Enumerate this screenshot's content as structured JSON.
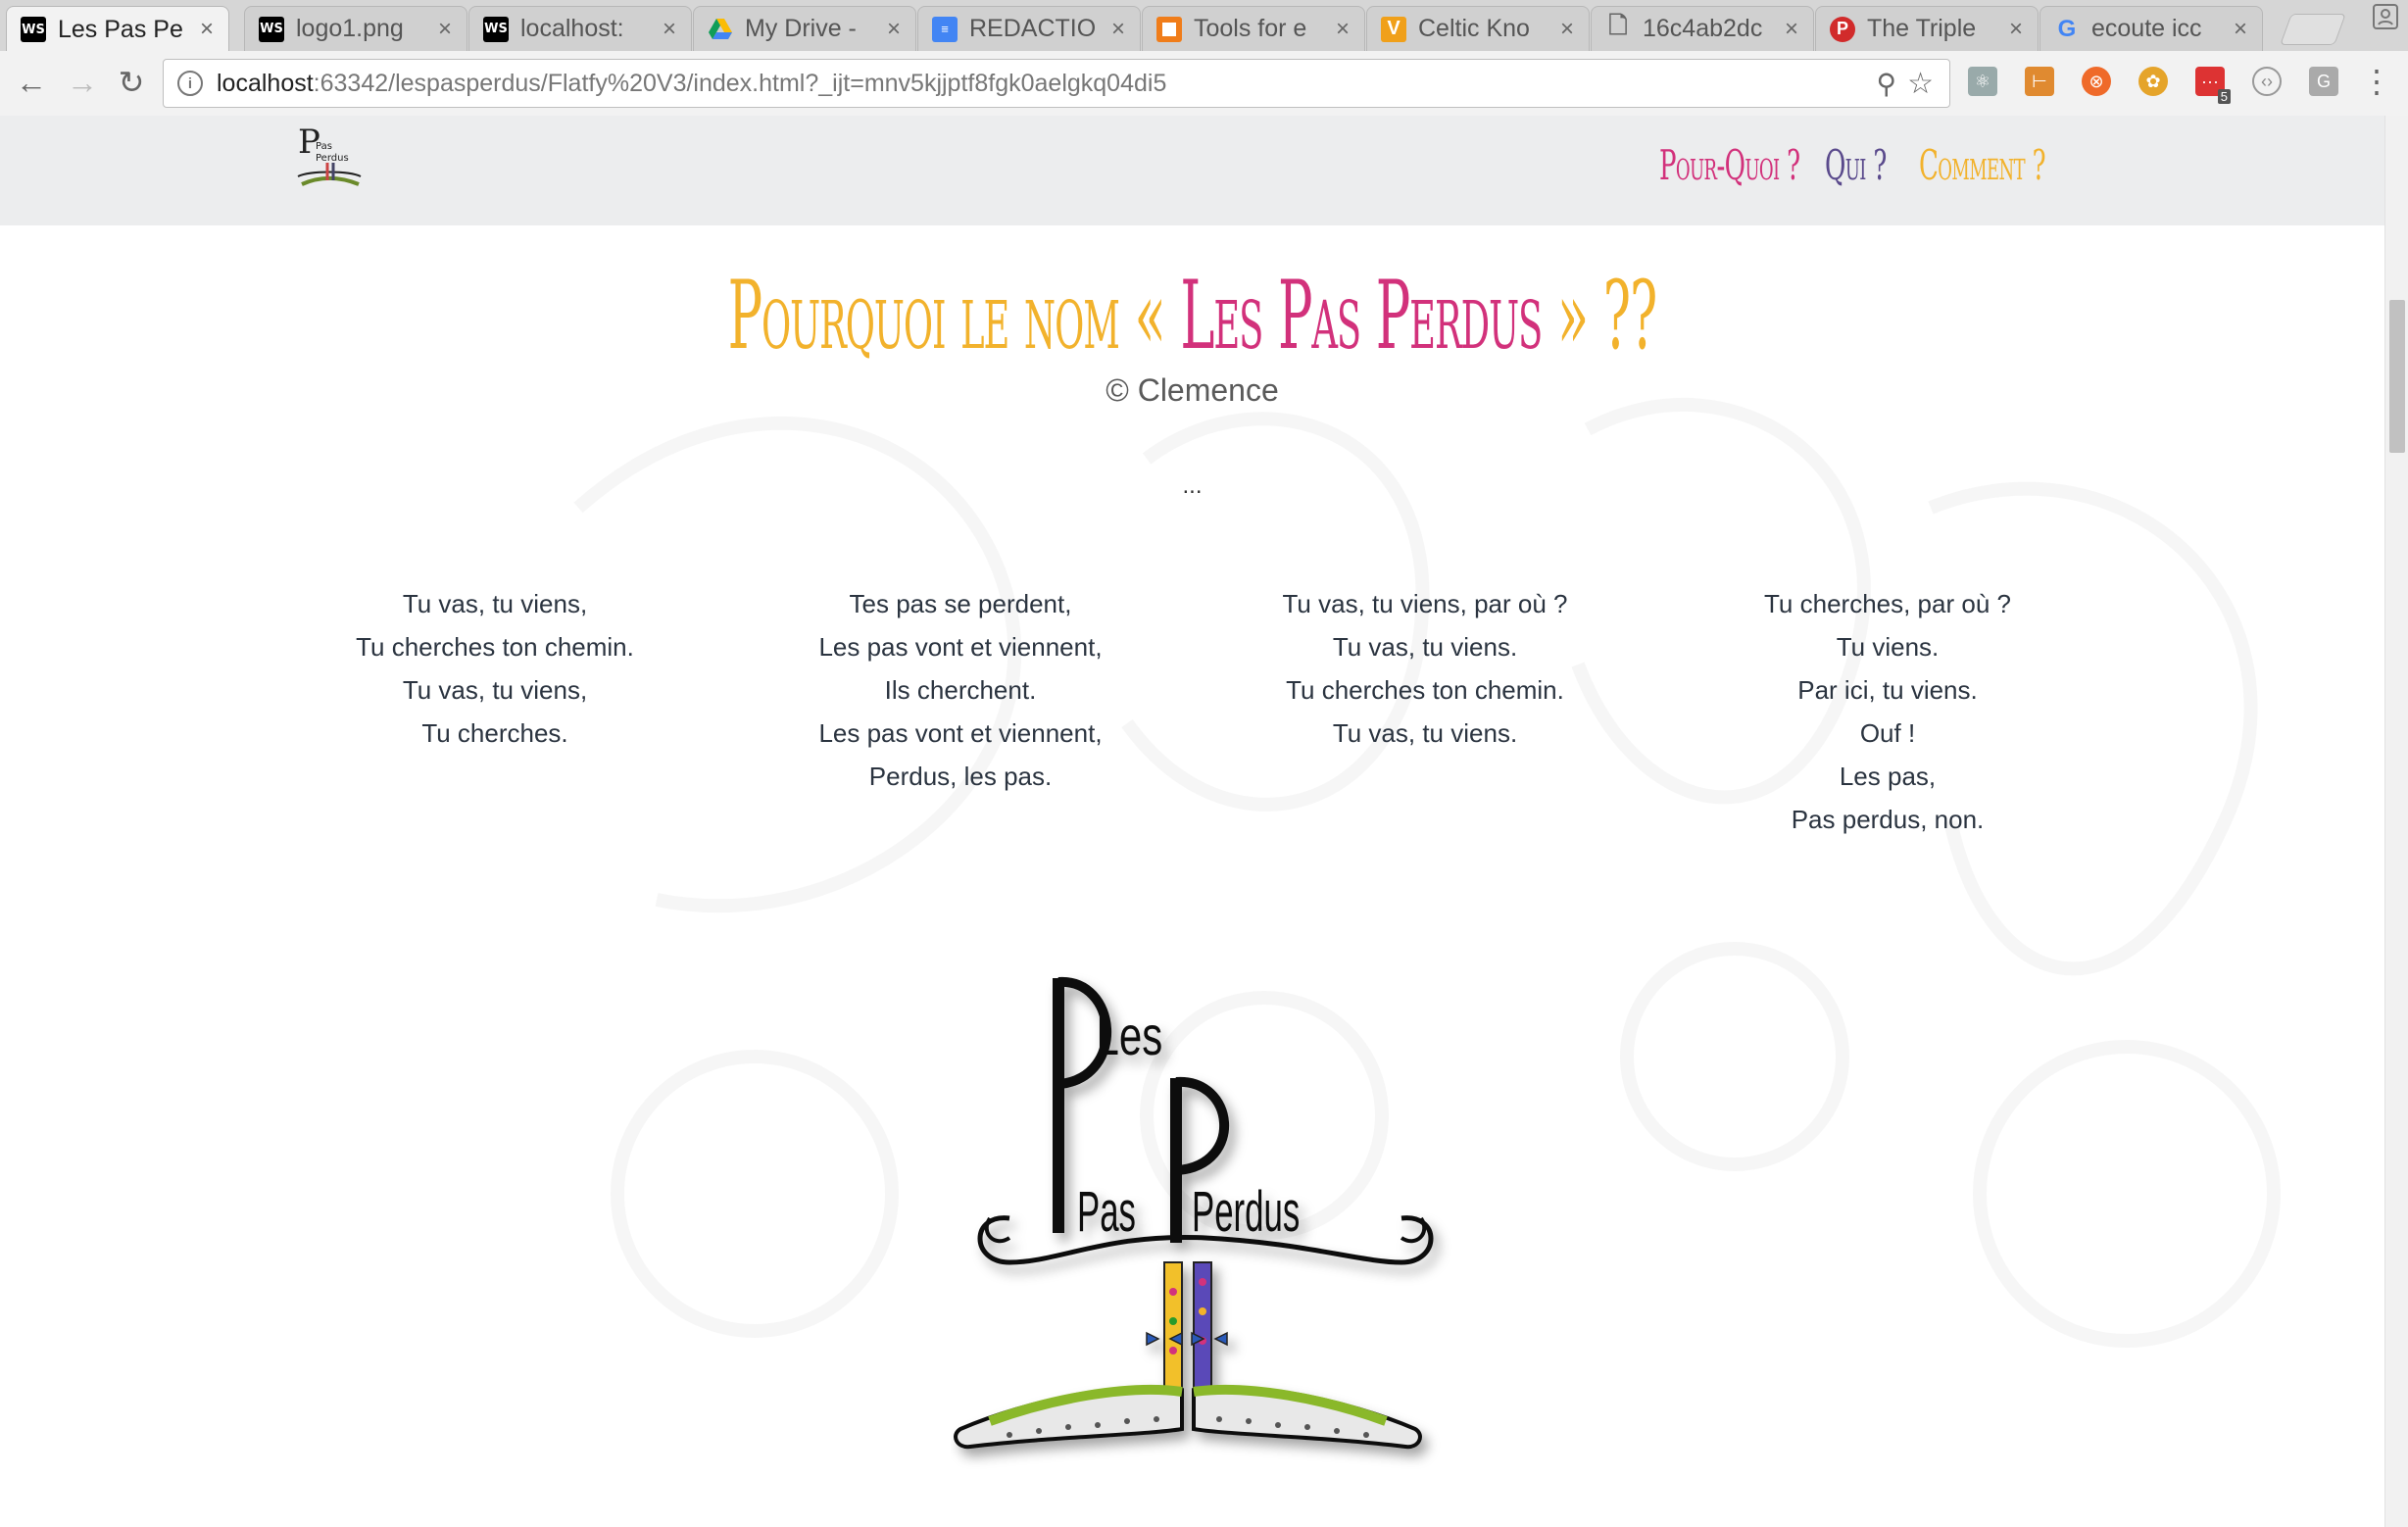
{
  "browser": {
    "tabs": [
      {
        "label": "Les Pas Pe",
        "icon": "webstorm-icon",
        "active": true
      },
      {
        "label": "logo1.png",
        "icon": "webstorm-icon",
        "active": false
      },
      {
        "label": "localhost:",
        "icon": "webstorm-icon",
        "active": false
      },
      {
        "label": "My Drive -",
        "icon": "google-drive-icon",
        "active": false
      },
      {
        "label": "REDACTIO",
        "icon": "google-docs-icon",
        "active": false
      },
      {
        "label": "Tools for e",
        "icon": "tools-icon",
        "active": false
      },
      {
        "label": "Celtic Kno",
        "icon": "v-icon",
        "active": false
      },
      {
        "label": "16c4ab2dc",
        "icon": "file-icon",
        "active": false
      },
      {
        "label": "The Triple",
        "icon": "pinterest-icon",
        "active": false
      },
      {
        "label": "ecoute icc",
        "icon": "google-icon",
        "active": false
      }
    ],
    "close_glyph": "×",
    "address": {
      "host": "localhost",
      "path": ":63342/lespasperdus/Flatfy%20V3/index.html?_ijt=mnv5kjjptf8fgk0aelgkq04di5"
    },
    "extension_badge": "5"
  },
  "site": {
    "nav": {
      "items": [
        "Pour-Quoi ?",
        "Qui ?",
        "Comment ?"
      ],
      "colors": [
        "#d2317b",
        "#5a4a8c",
        "#f2b22c"
      ]
    },
    "title": {
      "part1": "Pourquoi le nom « ",
      "part2": "Les Pas Perdus",
      "part3": " » ??"
    },
    "credit": "© Clemence",
    "ellipsis": "...",
    "poem": [
      [
        "Tu vas, tu viens,",
        "Tu cherches ton chemin.",
        "Tu vas, tu viens,",
        "Tu cherches."
      ],
      [
        "Tes pas se perdent,",
        "Les pas vont et viennent,",
        "Ils cherchent.",
        "Les pas vont et viennent,",
        "Perdus, les pas."
      ],
      [
        "Tu vas, tu viens, par où ?",
        "Tu vas, tu viens.",
        "Tu cherches ton chemin.",
        "Tu vas, tu viens."
      ],
      [
        "Tu cherches, par où ?",
        "Tu viens.",
        "Par ici, tu viens.",
        "Ouf !",
        "Les pas,",
        "Pas perdus, non."
      ]
    ],
    "logo_text": {
      "line1": "Les",
      "line2": "Pas",
      "line3": "Perdus"
    },
    "colors": {
      "yellow": "#f2b22c",
      "pink": "#d2317b",
      "purple": "#5a4a8c",
      "nav_bg": "#ecedee"
    }
  }
}
